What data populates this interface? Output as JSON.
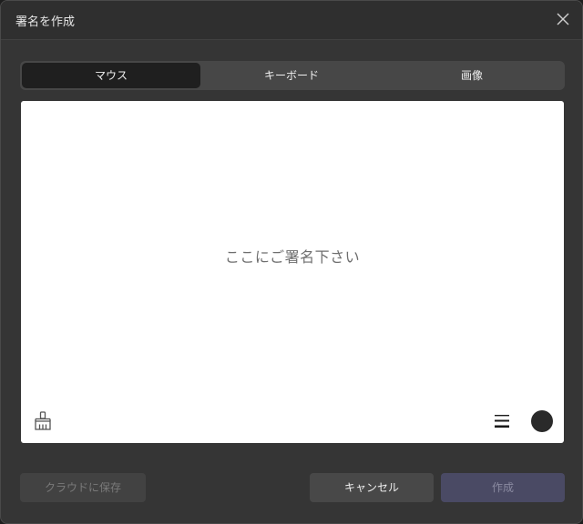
{
  "dialog": {
    "title": "署名を作成"
  },
  "tabs": [
    {
      "label": "マウス",
      "active": true
    },
    {
      "label": "キーボード",
      "active": false
    },
    {
      "label": "画像",
      "active": false
    }
  ],
  "canvas": {
    "placeholder": "ここにご署名下さい",
    "pen_color": "#2a2a2a"
  },
  "buttons": {
    "cloud_save": "クラウドに保存",
    "cancel": "キャンセル",
    "create": "作成"
  },
  "icons": {
    "close": "close-icon",
    "brush": "clear-brush-icon",
    "stroke": "stroke-width-icon"
  },
  "colors": {
    "dialog_bg": "#353535",
    "tab_active_bg": "#1f1f1f",
    "create_button_bg": "#4a4a64"
  }
}
